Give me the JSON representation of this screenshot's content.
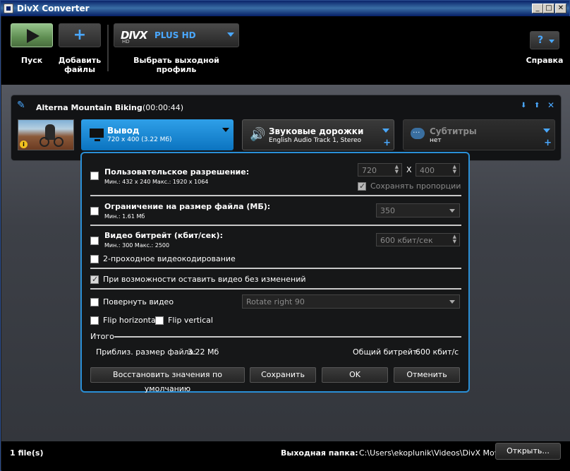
{
  "window": {
    "title": "DivX Converter",
    "min": "_",
    "max": "□",
    "close": "✕"
  },
  "toolbar": {
    "play_label": "Пуск",
    "add_label_1": "Добавить",
    "add_label_2": "файлы",
    "profile_brand": "DIVX",
    "profile_hd": "HD",
    "profile_name": "PLUS HD",
    "profile_label": "Выбрать выходной профиль",
    "help_symbol": "?",
    "help_label": "Справка"
  },
  "job": {
    "title": "Alterna Mountain Biking",
    "duration": "(00:00:44)",
    "output": {
      "label": "Вывод",
      "sub": "720 x 400 (3.22 Мб)"
    },
    "audio": {
      "label": "Звуковые дорожки",
      "sub": "English Audio Track 1, Stereo"
    },
    "subs": {
      "label": "Субтитры",
      "sub": "нет"
    }
  },
  "dialog": {
    "custom_res": {
      "label": "Пользовательское разрешение:",
      "hint": "Мин.: 432 x 240   Макс.: 1920 x 1064",
      "width": "720",
      "x": "X",
      "height": "400",
      "keep_aspect": "Сохранять пропорции"
    },
    "size_limit": {
      "label": "Ограничение на размер файла (МБ):",
      "hint": "Мин.: 1.61 Мб",
      "value": "350"
    },
    "bitrate": {
      "label": "Видео битрейт (кбит/сек):",
      "hint": "Мин.: 300   Макс.: 2500",
      "value": "600 кбит/сек"
    },
    "two_pass": "2-проходное видеокодирование",
    "keep_unchanged": "При возможности оставить видео без изменений",
    "rotate": {
      "label": "Повернуть видео",
      "value": "Rotate right 90"
    },
    "flip_h": "Flip horizontal",
    "flip_v": "Flip vertical",
    "summary": {
      "title": "Итого",
      "size_label": "Приблиз. размер файла:",
      "size_value": "3.22 Мб",
      "bitrate_label": "Общий битрейт:",
      "bitrate_value": "600 кбит/с"
    },
    "buttons": {
      "reset": "Восстановить значения по умолчанию",
      "save": "Сохранить",
      "ok": "OK",
      "cancel": "Отменить"
    }
  },
  "status": {
    "files": "1 file(s)",
    "output_label": "Выходная папка:",
    "output_path": "C:\\Users\\ekoplunik\\Videos\\DivX Movies",
    "open_button": "Открыть..."
  }
}
